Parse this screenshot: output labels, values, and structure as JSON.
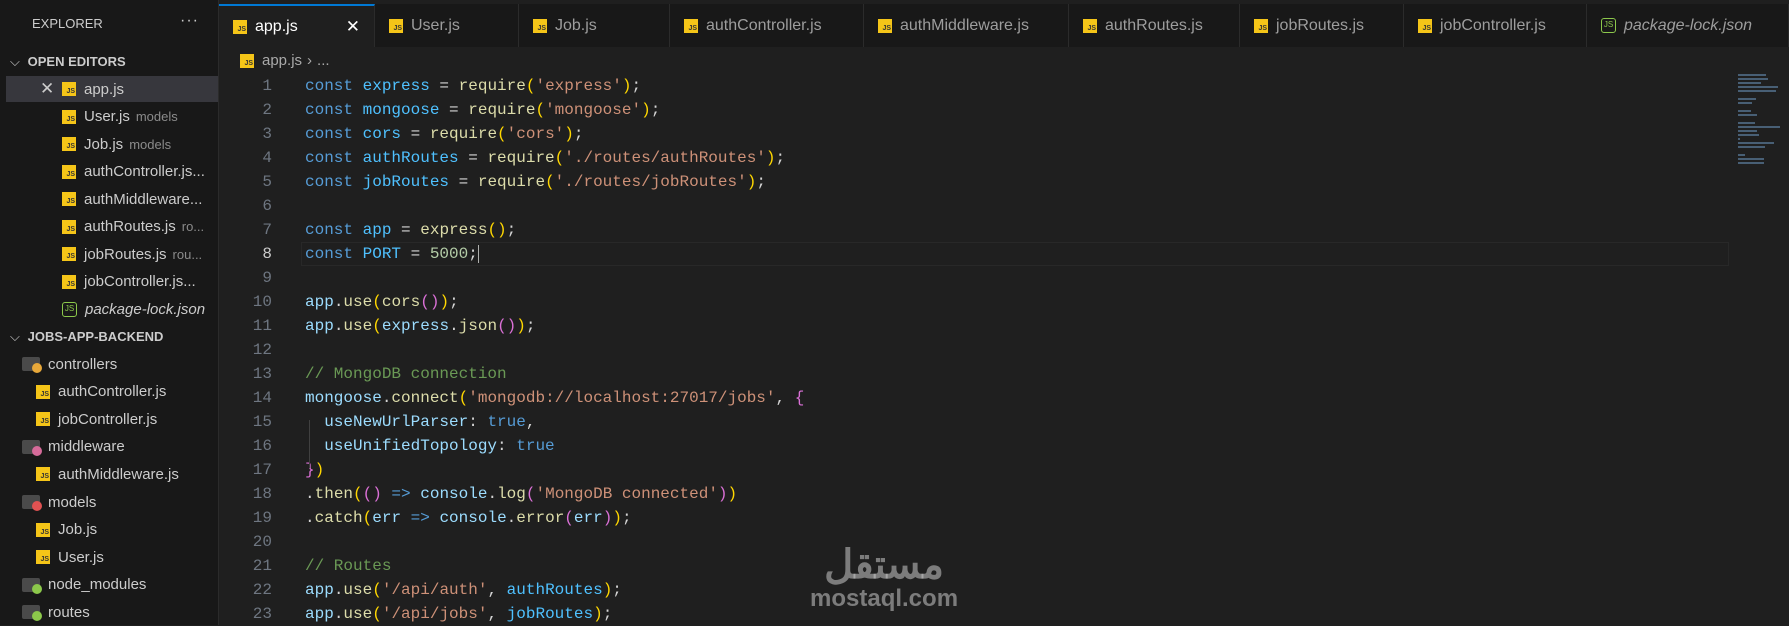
{
  "sidebar": {
    "title": "EXPLORER",
    "more": "···",
    "open_editors": {
      "label": "OPEN EDITORS",
      "items": [
        {
          "name": "app.js",
          "desc": "",
          "icon": "js"
        },
        {
          "name": "User.js",
          "desc": "models",
          "icon": "js"
        },
        {
          "name": "Job.js",
          "desc": "models",
          "icon": "js"
        },
        {
          "name": "authController.js...",
          "desc": "",
          "icon": "js"
        },
        {
          "name": "authMiddleware...",
          "desc": "",
          "icon": "js"
        },
        {
          "name": "authRoutes.js",
          "desc": "ro...",
          "icon": "js"
        },
        {
          "name": "jobRoutes.js",
          "desc": "rou...",
          "icon": "js"
        },
        {
          "name": "jobController.js...",
          "desc": "",
          "icon": "js"
        },
        {
          "name": "package-lock.json",
          "desc": "",
          "icon": "node"
        }
      ]
    },
    "project": {
      "label": "JOBS-APP-BACKEND",
      "items": [
        {
          "name": "controllers",
          "type": "folder",
          "color": "#e8a83a",
          "depth": 0
        },
        {
          "name": "authController.js",
          "type": "js",
          "depth": 1
        },
        {
          "name": "jobController.js",
          "type": "js",
          "depth": 1
        },
        {
          "name": "middleware",
          "type": "folder",
          "color": "#d66b9a",
          "depth": 0
        },
        {
          "name": "authMiddleware.js",
          "type": "js",
          "depth": 1
        },
        {
          "name": "models",
          "type": "folder",
          "color": "#e05252",
          "depth": 0
        },
        {
          "name": "Job.js",
          "type": "js",
          "depth": 1
        },
        {
          "name": "User.js",
          "type": "js",
          "depth": 1
        },
        {
          "name": "node_modules",
          "type": "folder",
          "color": "#8cc84b",
          "depth": 0
        },
        {
          "name": "routes",
          "type": "folder",
          "color": "#8cc84b",
          "depth": 0
        }
      ]
    }
  },
  "tabs": [
    {
      "label": "app.js",
      "icon": "js",
      "active": true
    },
    {
      "label": "User.js",
      "icon": "js"
    },
    {
      "label": "Job.js",
      "icon": "js"
    },
    {
      "label": "authController.js",
      "icon": "js"
    },
    {
      "label": "authMiddleware.js",
      "icon": "js"
    },
    {
      "label": "authRoutes.js",
      "icon": "js"
    },
    {
      "label": "jobRoutes.js",
      "icon": "js"
    },
    {
      "label": "jobController.js",
      "icon": "js"
    },
    {
      "label": "package-lock.json",
      "icon": "node",
      "italic": true
    }
  ],
  "close_glyph": "✕",
  "breadcrumb": {
    "file": "app.js",
    "sep": "›",
    "rest": "..."
  },
  "current_line": 8,
  "code": [
    [
      [
        "k",
        "const "
      ],
      [
        "v",
        "express"
      ],
      [
        "o",
        " = "
      ],
      [
        "f",
        "require"
      ],
      [
        "b1",
        "("
      ],
      [
        "s",
        "'express'"
      ],
      [
        "b1",
        ")"
      ],
      [
        "o",
        ";"
      ]
    ],
    [
      [
        "k",
        "const "
      ],
      [
        "v",
        "mongoose"
      ],
      [
        "o",
        " = "
      ],
      [
        "f",
        "require"
      ],
      [
        "b1",
        "("
      ],
      [
        "s",
        "'mongoose'"
      ],
      [
        "b1",
        ")"
      ],
      [
        "o",
        ";"
      ]
    ],
    [
      [
        "k",
        "const "
      ],
      [
        "v",
        "cors"
      ],
      [
        "o",
        " = "
      ],
      [
        "f",
        "require"
      ],
      [
        "b1",
        "("
      ],
      [
        "s",
        "'cors'"
      ],
      [
        "b1",
        ")"
      ],
      [
        "o",
        ";"
      ]
    ],
    [
      [
        "k",
        "const "
      ],
      [
        "v",
        "authRoutes"
      ],
      [
        "o",
        " = "
      ],
      [
        "f",
        "require"
      ],
      [
        "b1",
        "("
      ],
      [
        "s",
        "'./routes/authRoutes'"
      ],
      [
        "b1",
        ")"
      ],
      [
        "o",
        ";"
      ]
    ],
    [
      [
        "k",
        "const "
      ],
      [
        "v",
        "jobRoutes"
      ],
      [
        "o",
        " = "
      ],
      [
        "f",
        "require"
      ],
      [
        "b1",
        "("
      ],
      [
        "s",
        "'./routes/jobRoutes'"
      ],
      [
        "b1",
        ")"
      ],
      [
        "o",
        ";"
      ]
    ],
    [],
    [
      [
        "k",
        "const "
      ],
      [
        "v",
        "app"
      ],
      [
        "o",
        " = "
      ],
      [
        "f",
        "express"
      ],
      [
        "b1",
        "()"
      ],
      [
        "o",
        ";"
      ]
    ],
    [
      [
        "k",
        "const "
      ],
      [
        "v",
        "PORT"
      ],
      [
        "o",
        " = "
      ],
      [
        "n",
        "5000"
      ],
      [
        "o",
        ";"
      ]
    ],
    [],
    [
      [
        "p",
        "app"
      ],
      [
        "o",
        "."
      ],
      [
        "f",
        "use"
      ],
      [
        "b1",
        "("
      ],
      [
        "f",
        "cors"
      ],
      [
        "b2",
        "()"
      ],
      [
        "b1",
        ")"
      ],
      [
        "o",
        ";"
      ]
    ],
    [
      [
        "p",
        "app"
      ],
      [
        "o",
        "."
      ],
      [
        "f",
        "use"
      ],
      [
        "b1",
        "("
      ],
      [
        "p",
        "express"
      ],
      [
        "o",
        "."
      ],
      [
        "f",
        "json"
      ],
      [
        "b2",
        "()"
      ],
      [
        "b1",
        ")"
      ],
      [
        "o",
        ";"
      ]
    ],
    [],
    [
      [
        "c",
        "// MongoDB connection"
      ]
    ],
    [
      [
        "p",
        "mongoose"
      ],
      [
        "o",
        "."
      ],
      [
        "f",
        "connect"
      ],
      [
        "b1",
        "("
      ],
      [
        "s",
        "'mongodb://localhost:27017/jobs'"
      ],
      [
        "o",
        ", "
      ],
      [
        "b2",
        "{"
      ]
    ],
    [
      [
        "o",
        "  "
      ],
      [
        "p",
        "useNewUrlParser"
      ],
      [
        "o",
        ": "
      ],
      [
        "k",
        "true"
      ],
      [
        "o",
        ","
      ]
    ],
    [
      [
        "o",
        "  "
      ],
      [
        "p",
        "useUnifiedTopology"
      ],
      [
        "o",
        ": "
      ],
      [
        "k",
        "true"
      ]
    ],
    [
      [
        "b2",
        "}"
      ],
      [
        "b1",
        ")"
      ]
    ],
    [
      [
        "o",
        "."
      ],
      [
        "f",
        "then"
      ],
      [
        "b1",
        "("
      ],
      [
        "b2",
        "()"
      ],
      [
        "k",
        " => "
      ],
      [
        "p",
        "console"
      ],
      [
        "o",
        "."
      ],
      [
        "f",
        "log"
      ],
      [
        "b2",
        "("
      ],
      [
        "s",
        "'MongoDB connected'"
      ],
      [
        "b2",
        ")"
      ],
      [
        "b1",
        ")"
      ]
    ],
    [
      [
        "o",
        "."
      ],
      [
        "f",
        "catch"
      ],
      [
        "b1",
        "("
      ],
      [
        "p",
        "err"
      ],
      [
        "k",
        " => "
      ],
      [
        "p",
        "console"
      ],
      [
        "o",
        "."
      ],
      [
        "f",
        "error"
      ],
      [
        "b2",
        "("
      ],
      [
        "p",
        "err"
      ],
      [
        "b2",
        ")"
      ],
      [
        "b1",
        ")"
      ],
      [
        "o",
        ";"
      ]
    ],
    [],
    [
      [
        "c",
        "// Routes"
      ]
    ],
    [
      [
        "p",
        "app"
      ],
      [
        "o",
        "."
      ],
      [
        "f",
        "use"
      ],
      [
        "b1",
        "("
      ],
      [
        "s",
        "'/api/auth'"
      ],
      [
        "o",
        ", "
      ],
      [
        "v",
        "authRoutes"
      ],
      [
        "b1",
        ")"
      ],
      [
        "o",
        ";"
      ]
    ],
    [
      [
        "p",
        "app"
      ],
      [
        "o",
        "."
      ],
      [
        "f",
        "use"
      ],
      [
        "b1",
        "("
      ],
      [
        "s",
        "'/api/jobs'"
      ],
      [
        "o",
        ", "
      ],
      [
        "v",
        "jobRoutes"
      ],
      [
        "b1",
        ")"
      ],
      [
        "o",
        ";"
      ]
    ]
  ],
  "watermark": {
    "arabic": "مستقل",
    "latin": "mostaql.com"
  }
}
